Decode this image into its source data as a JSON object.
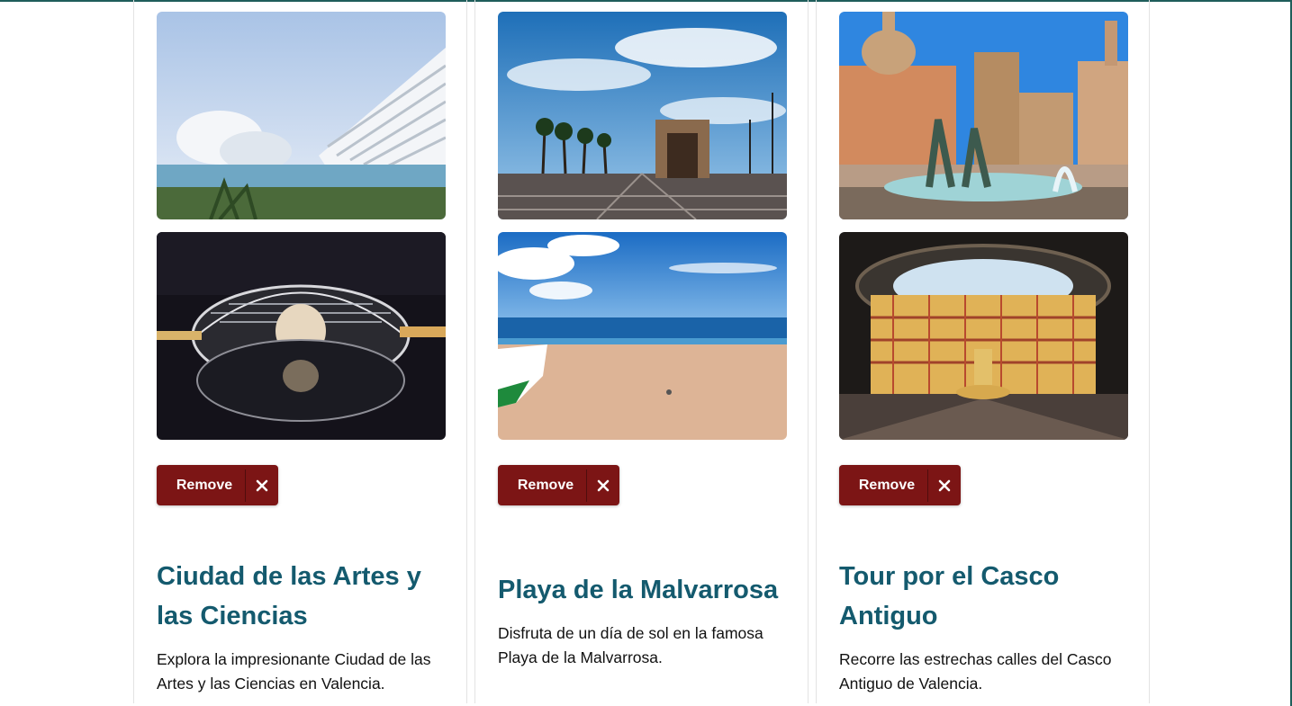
{
  "cards": [
    {
      "title": "Ciudad de las Artes y las Ciencias",
      "description": "Explora la impresionante Ciudad de las Artes y las Ciencias en Valencia.",
      "remove_label": "Remove"
    },
    {
      "title": "Playa de la Malvarrosa",
      "description": "Disfruta de un día de sol en la famosa Playa de la Malvarrosa.",
      "remove_label": "Remove"
    },
    {
      "title": "Tour por el Casco Antiguo",
      "description": "Recorre las estrechas calles del Casco Antiguo de Valencia.",
      "remove_label": "Remove"
    }
  ],
  "colors": {
    "title": "#145a6e",
    "remove_button": "#7c1515",
    "frame_border": "#1f5e5b"
  },
  "icons": {
    "remove": "close-icon"
  }
}
